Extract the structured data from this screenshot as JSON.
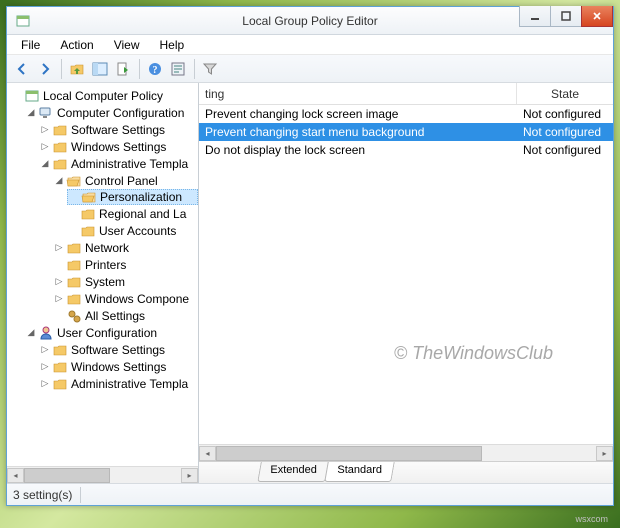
{
  "window": {
    "title": "Local Group Policy Editor"
  },
  "menu": {
    "file": "File",
    "action": "Action",
    "view": "View",
    "help": "Help"
  },
  "tree": {
    "root": "Local Computer Policy",
    "cc": "Computer Configuration",
    "cc_sw": "Software Settings",
    "cc_win": "Windows Settings",
    "cc_adm": "Administrative Templa",
    "cc_cp": "Control Panel",
    "cc_cp_pers": "Personalization",
    "cc_cp_reg": "Regional and La",
    "cc_cp_ua": "User Accounts",
    "cc_net": "Network",
    "cc_prn": "Printers",
    "cc_sys": "System",
    "cc_wcom": "Windows Compone",
    "cc_all": "All Settings",
    "uc": "User Configuration",
    "uc_sw": "Software Settings",
    "uc_win": "Windows Settings",
    "uc_adm": "Administrative Templa"
  },
  "list": {
    "header_setting_trunc": "ting",
    "header_state": "State",
    "rows": [
      {
        "setting": "Prevent changing lock screen image",
        "state": "Not configured"
      },
      {
        "setting": "Prevent changing start menu background",
        "state": "Not configured"
      },
      {
        "setting": "Do not display the lock screen",
        "state": "Not configured"
      }
    ],
    "selected_index": 1
  },
  "tabs": {
    "extended": "Extended",
    "standard": "Standard"
  },
  "status": {
    "count": "3 setting(s)"
  },
  "watermark": "© TheWindowsClub",
  "corner": "wsxcom"
}
